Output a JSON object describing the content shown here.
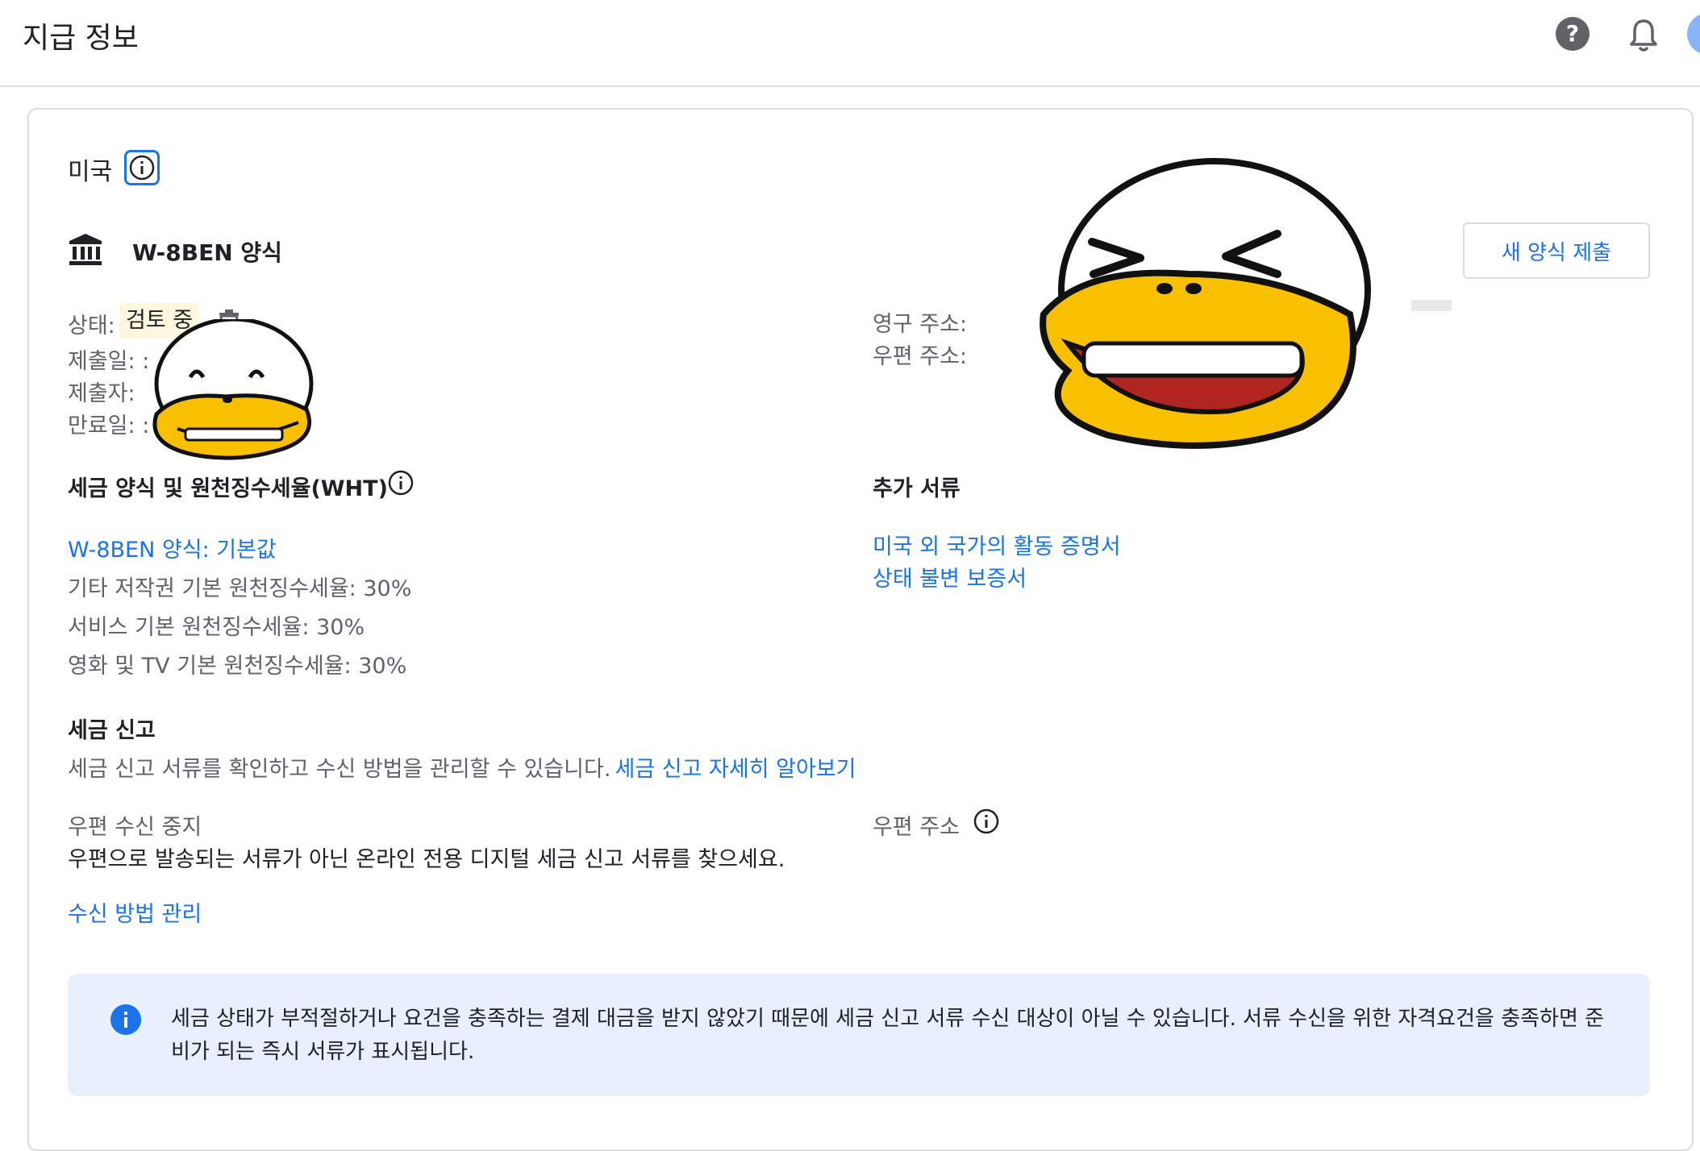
{
  "header": {
    "title": "지급 정보",
    "icons": [
      "help-icon",
      "bell-icon",
      "avatar"
    ]
  },
  "card": {
    "country": "미국",
    "form_name": "W-8BEN 양식",
    "submit_button": "새 양식 제출",
    "status": {
      "status_label": "상태:",
      "status_value": "검토 중",
      "submitted_label": "제출일: :",
      "submitter_label": "제출자:",
      "expires_label": "만료일: :"
    },
    "address": {
      "permanent_label": "영구 주소:",
      "mailing_label": "우편 주소:"
    },
    "tax_section": {
      "title": "세금 양식 및 원천징수세율(WHT)",
      "form_link": "W-8BEN 양식: 기본값",
      "rates": [
        "기타 저작권 기본 원천징수세율: 30%",
        "서비스 기본 원천징수세율: 30%",
        "영화 및 TV 기본 원천징수세율: 30%"
      ]
    },
    "extra_docs": {
      "title": "추가 서류",
      "links": [
        "미국 외 국가의 활동 증명서",
        "상태 불변 보증서"
      ]
    },
    "tax_filing": {
      "title": "세금 신고",
      "description": "세금 신고 서류를 확인하고 수신 방법을 관리할 수 있습니다.",
      "learn_more": "세금 신고 자세히 알아보기",
      "mail_stop_label": "우편 수신 중지",
      "mail_stop_text": "우편으로 발송되는 서류가 아닌 온라인 전용 디지털 세금 신고 서류를 찾으세요.",
      "manage_link": "수신 방법 관리",
      "mail_address_label": "우편 주소"
    },
    "notice": {
      "text": "세금 상태가 부적절하거나 요건을 충족하는 결제 대금을 받지 않았기 때문에 세금 신고 서류 수신 대상이 아닐 수 있습니다. 서류 수신을 위한 자격요건을 충족하면 준비가 되는 즉시 서류가 표시됩니다."
    }
  },
  "colors": {
    "link": "#1a73e8",
    "status_chip_bg": "#fef7e0",
    "notice_bg": "#e8f0fe",
    "sticker_yellow": "#f9c000"
  }
}
